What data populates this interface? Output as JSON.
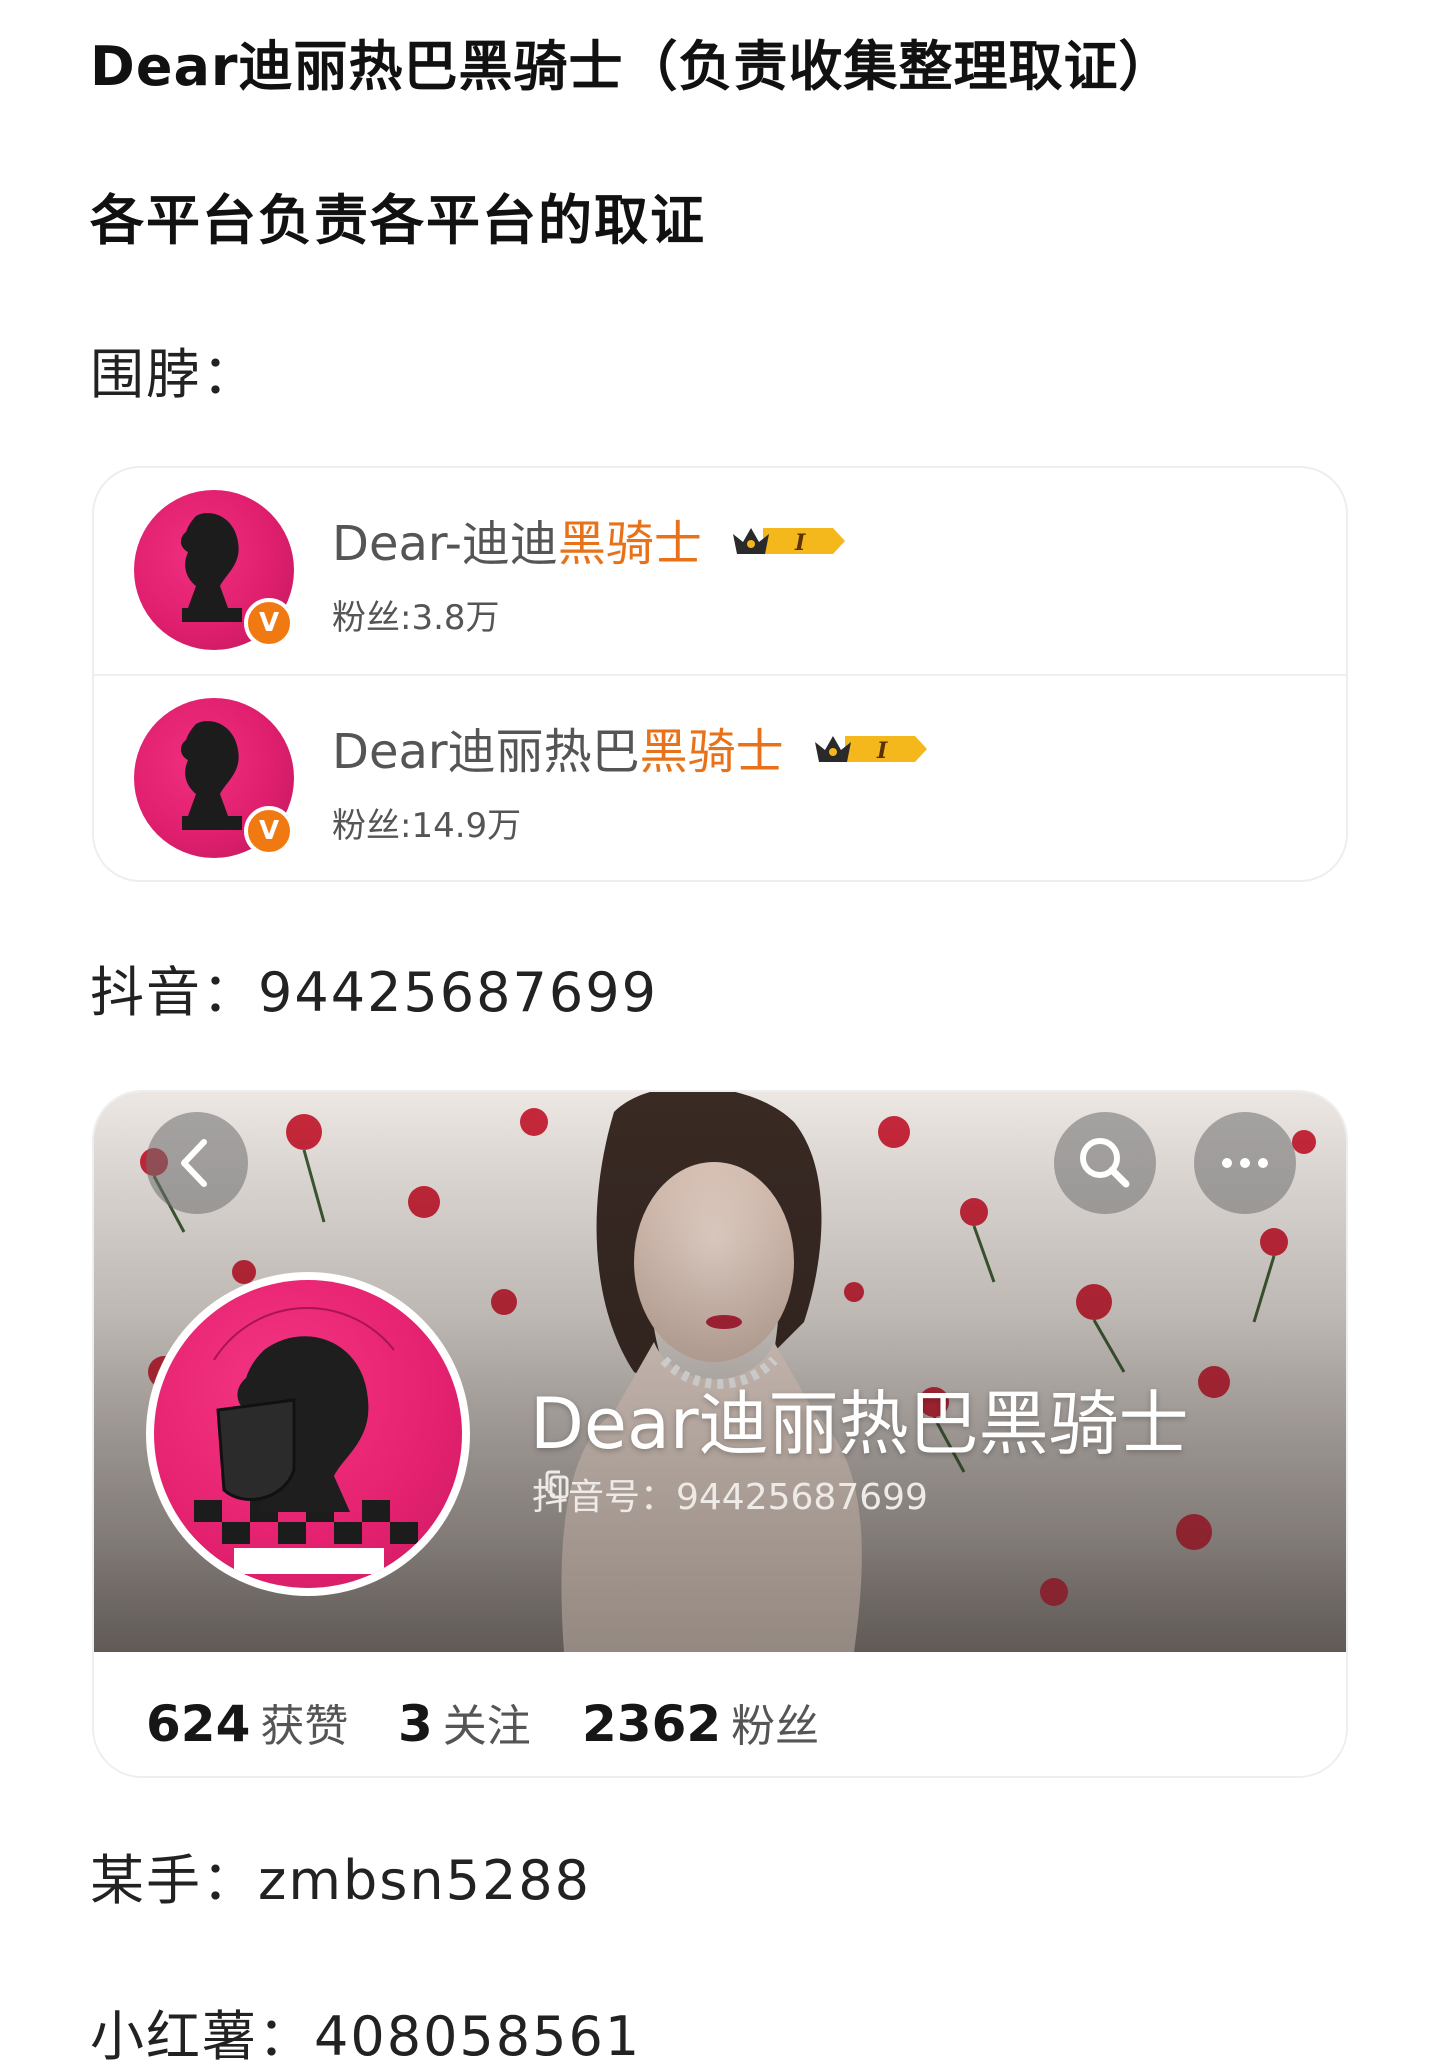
{
  "header": {
    "title": "Dear迪丽热巴黑骑士（负责收集整理取证）",
    "subtitle": "各平台负责各平台的取证"
  },
  "weibo": {
    "label": "围脖：",
    "accounts": [
      {
        "name_prefix": "Dear-迪迪",
        "name_highlight": "黑骑士",
        "fans": "粉丝:3.8万",
        "badge": "V"
      },
      {
        "name_prefix": "Dear迪丽热巴",
        "name_highlight": "黑骑士",
        "fans": "粉丝:14.9万",
        "badge": "V"
      }
    ],
    "colors": {
      "highlight": "#e8721a",
      "verified_badge": "#f07a11",
      "avatar_pink": "#e01f6e"
    }
  },
  "douyin": {
    "label": "抖音：94425687699",
    "profile": {
      "name": "Dear迪丽热巴黑骑士",
      "id_line": "抖音号：94425687699",
      "stats": [
        {
          "num": "624",
          "label": "获赞"
        },
        {
          "num": "3",
          "label": "关注"
        },
        {
          "num": "2362",
          "label": "粉丝"
        }
      ],
      "icons": [
        "back-icon",
        "search-icon",
        "more-icon",
        "copy-icon"
      ]
    }
  },
  "kuaishou": {
    "label": "某手：zmbsn5288"
  },
  "xiaohongshu": {
    "label": "小红薯：408058561"
  }
}
